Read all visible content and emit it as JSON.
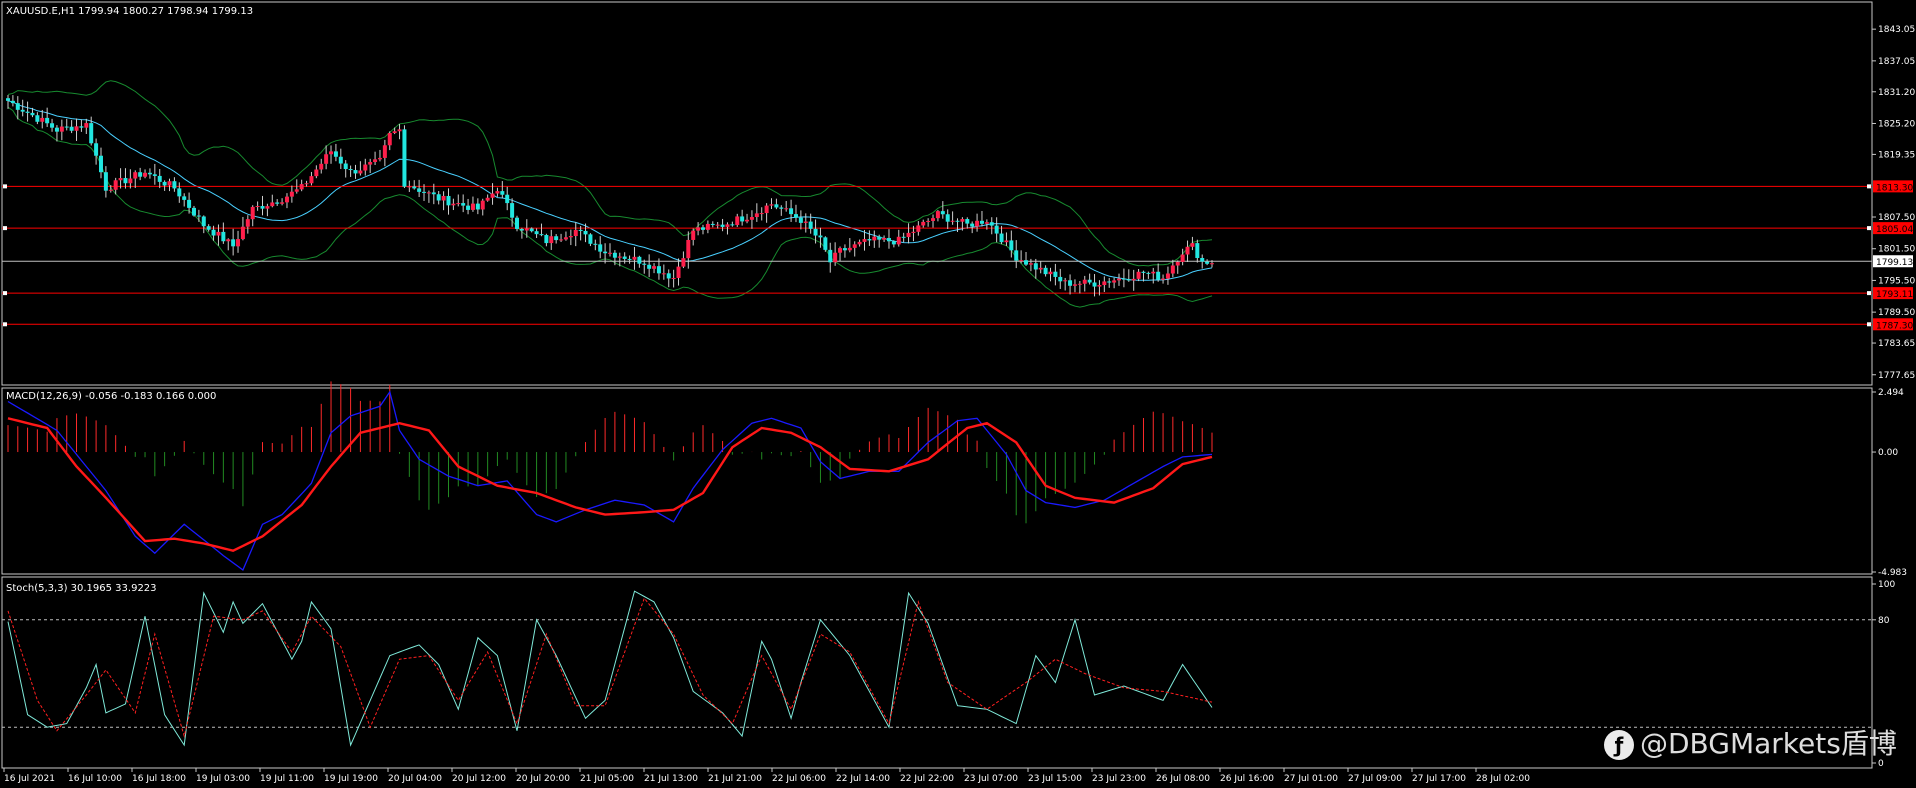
{
  "colors": {
    "bg": "#000000",
    "frame": "#c8c8c8",
    "bull": "#ff1f4b",
    "bear": "#21e6e0",
    "ma": "#49d0ff",
    "bands": "#178a2f",
    "level": "#ff0000",
    "current": "#c0c0c0",
    "macd_line": "#1a1aff",
    "macd_signal": "#ff1818",
    "hist_pos": "#ff2a2a",
    "hist_neg": "#228b22",
    "stoch_main": "#7fe9d9",
    "stoch_signal": "#ff2020",
    "text": "#ffffff"
  },
  "main": {
    "header": "XAUUSD.E,H1  1799.94 1800.27 1798.94 1799.13",
    "ylim": [
      1775.9,
      1848.0
    ],
    "ticks": [
      "1843.05",
      "1837.05",
      "1831.20",
      "1825.20",
      "1819.35",
      "1807.50",
      "1801.50",
      "1795.50",
      "1789.50",
      "1783.65",
      "1777.65"
    ],
    "current_price": "1799.13",
    "levels": [
      {
        "value": 1813.3,
        "label": "1813.30"
      },
      {
        "value": 1805.4,
        "label": "1805.04"
      },
      {
        "value": 1793.1,
        "label": "1793.11"
      },
      {
        "value": 1787.2,
        "label": "1787.30"
      }
    ]
  },
  "macd": {
    "header": "MACD(12,26,9) -0.056 -0.183 0.166 0.000",
    "ylim": [
      -4.983,
      2.494
    ],
    "ticks": [
      "2.494",
      "0.00",
      "-4.983"
    ]
  },
  "stoch": {
    "header": "Stoch(5,3,3) 30.1965 33.9223",
    "ylim": [
      0,
      100
    ],
    "ticks": [
      "100",
      "80",
      "0"
    ],
    "levels": [
      80,
      20
    ]
  },
  "time_labels": [
    "16 Jul 2021",
    "16 Jul 10:00",
    "16 Jul 18:00",
    "19 Jul 03:00",
    "19 Jul 11:00",
    "19 Jul 19:00",
    "20 Jul 04:00",
    "20 Jul 12:00",
    "20 Jul 20:00",
    "21 Jul 05:00",
    "21 Jul 13:00",
    "21 Jul 21:00",
    "22 Jul 06:00",
    "22 Jul 14:00",
    "22 Jul 22:00",
    "23 Jul 07:00",
    "23 Jul 15:00",
    "23 Jul 23:00",
    "26 Jul 08:00",
    "26 Jul 16:00",
    "27 Jul 01:00",
    "27 Jul 09:00",
    "27 Jul 17:00",
    "28 Jul 02:00"
  ],
  "watermark": "@DBGMarkets盾博",
  "chart_data": [
    {
      "type": "candlestick",
      "title": "XAUUSD.E,H1",
      "ohlc_last": {
        "open": 1799.94,
        "high": 1800.27,
        "low": 1798.94,
        "close": 1799.13
      },
      "ylim": [
        1775.9,
        1848.0
      ],
      "close_path": [
        [
          0,
          1829.5
        ],
        [
          10,
          1824
        ],
        [
          16,
          1825
        ],
        [
          20,
          1813
        ],
        [
          28,
          1816
        ],
        [
          34,
          1813
        ],
        [
          40,
          1806
        ],
        [
          46,
          1802
        ],
        [
          50,
          1809
        ],
        [
          56,
          1811
        ],
        [
          60,
          1813
        ],
        [
          66,
          1820
        ],
        [
          70,
          1816
        ],
        [
          76,
          1818
        ],
        [
          78,
          1823
        ],
        [
          80,
          1824
        ],
        [
          81,
          1814
        ],
        [
          88,
          1811
        ],
        [
          96,
          1809
        ],
        [
          100,
          1813
        ],
        [
          104,
          1806
        ],
        [
          110,
          1803
        ],
        [
          116,
          1805
        ],
        [
          122,
          1801
        ],
        [
          130,
          1799
        ],
        [
          136,
          1796
        ],
        [
          140,
          1805
        ],
        [
          146,
          1806
        ],
        [
          152,
          1808
        ],
        [
          156,
          1810
        ],
        [
          162,
          1807
        ],
        [
          166,
          1803
        ],
        [
          168,
          1799
        ],
        [
          170,
          1801
        ],
        [
          176,
          1803
        ],
        [
          182,
          1803
        ],
        [
          190,
          1808
        ],
        [
          196,
          1806
        ],
        [
          200,
          1807
        ],
        [
          206,
          1800
        ],
        [
          212,
          1797
        ],
        [
          216,
          1795
        ],
        [
          222,
          1795
        ],
        [
          228,
          1796
        ],
        [
          232,
          1797
        ],
        [
          236,
          1796
        ],
        [
          240,
          1801
        ],
        [
          242,
          1802
        ],
        [
          244,
          1799
        ],
        [
          246,
          1799
        ]
      ],
      "horizontal_levels": [
        1813.3,
        1805.04,
        1793.11,
        1787.3
      ],
      "current": 1799.13
    },
    {
      "type": "line",
      "title": "MACD(12,26,9)",
      "values_last": {
        "macd": -0.056,
        "signal": -0.183,
        "hist": 0.166
      },
      "ylim": [
        -4.983,
        2.494
      ],
      "series": [
        {
          "name": "MACD",
          "values": [
            [
              0,
              2.1
            ],
            [
              10,
              0.9
            ],
            [
              20,
              -1.6
            ],
            [
              26,
              -3.5
            ],
            [
              30,
              -4.2
            ],
            [
              36,
              -3.0
            ],
            [
              44,
              -4.3
            ],
            [
              48,
              -4.9
            ],
            [
              52,
              -3.0
            ],
            [
              56,
              -2.6
            ],
            [
              62,
              -1.3
            ],
            [
              66,
              0.8
            ],
            [
              70,
              1.5
            ],
            [
              76,
              1.9
            ],
            [
              78,
              2.5
            ],
            [
              80,
              0.9
            ],
            [
              84,
              -0.3
            ],
            [
              90,
              -1.0
            ],
            [
              96,
              -1.4
            ],
            [
              102,
              -1.2
            ],
            [
              108,
              -2.6
            ],
            [
              112,
              -2.9
            ],
            [
              118,
              -2.4
            ],
            [
              124,
              -2.0
            ],
            [
              130,
              -2.2
            ],
            [
              136,
              -2.9
            ],
            [
              140,
              -1.5
            ],
            [
              146,
              0.1
            ],
            [
              152,
              1.2
            ],
            [
              156,
              1.4
            ],
            [
              162,
              1.0
            ],
            [
              166,
              -0.4
            ],
            [
              170,
              -1.1
            ],
            [
              176,
              -0.8
            ],
            [
              182,
              -0.8
            ],
            [
              188,
              0.4
            ],
            [
              194,
              1.3
            ],
            [
              198,
              1.4
            ],
            [
              204,
              -0.1
            ],
            [
              208,
              -1.6
            ],
            [
              212,
              -2.1
            ],
            [
              218,
              -2.3
            ],
            [
              224,
              -2.0
            ],
            [
              230,
              -1.3
            ],
            [
              236,
              -0.6
            ],
            [
              240,
              -0.2
            ],
            [
              246,
              -0.1
            ]
          ]
        },
        {
          "name": "Signal",
          "values": [
            [
              0,
              1.4
            ],
            [
              8,
              1.0
            ],
            [
              14,
              -0.6
            ],
            [
              20,
              -1.9
            ],
            [
              28,
              -3.7
            ],
            [
              34,
              -3.6
            ],
            [
              40,
              -3.8
            ],
            [
              46,
              -4.1
            ],
            [
              52,
              -3.5
            ],
            [
              60,
              -2.2
            ],
            [
              66,
              -0.6
            ],
            [
              72,
              0.8
            ],
            [
              80,
              1.2
            ],
            [
              86,
              0.9
            ],
            [
              92,
              -0.6
            ],
            [
              100,
              -1.4
            ],
            [
              108,
              -1.7
            ],
            [
              116,
              -2.3
            ],
            [
              122,
              -2.6
            ],
            [
              130,
              -2.5
            ],
            [
              136,
              -2.4
            ],
            [
              142,
              -1.7
            ],
            [
              148,
              0.2
            ],
            [
              154,
              1.0
            ],
            [
              160,
              0.8
            ],
            [
              166,
              0.2
            ],
            [
              172,
              -0.7
            ],
            [
              180,
              -0.8
            ],
            [
              188,
              -0.3
            ],
            [
              196,
              1.0
            ],
            [
              200,
              1.2
            ],
            [
              206,
              0.4
            ],
            [
              212,
              -1.4
            ],
            [
              218,
              -1.9
            ],
            [
              226,
              -2.1
            ],
            [
              234,
              -1.5
            ],
            [
              240,
              -0.5
            ],
            [
              246,
              -0.2
            ]
          ]
        }
      ]
    },
    {
      "type": "line",
      "title": "Stoch(5,3,3)",
      "values_last": {
        "main": 30.1965,
        "signal": 33.9223
      },
      "ylim": [
        0,
        100
      ],
      "series": [
        {
          "name": "Main",
          "values": [
            [
              0,
              79
            ],
            [
              4,
              27
            ],
            [
              8,
              20
            ],
            [
              12,
              22
            ],
            [
              16,
              42
            ],
            [
              18,
              55
            ],
            [
              20,
              28
            ],
            [
              24,
              33
            ],
            [
              28,
              82
            ],
            [
              32,
              27
            ],
            [
              36,
              10
            ],
            [
              40,
              95
            ],
            [
              44,
              73
            ],
            [
              46,
              90
            ],
            [
              48,
              78
            ],
            [
              52,
              89
            ],
            [
              58,
              58
            ],
            [
              60,
              68
            ],
            [
              62,
              90
            ],
            [
              66,
              75
            ],
            [
              70,
              10
            ],
            [
              74,
              35
            ],
            [
              78,
              60
            ],
            [
              84,
              66
            ],
            [
              88,
              55
            ],
            [
              92,
              30
            ],
            [
              96,
              70
            ],
            [
              100,
              60
            ],
            [
              104,
              18
            ],
            [
              108,
              80
            ],
            [
              112,
              60
            ],
            [
              118,
              25
            ],
            [
              122,
              35
            ],
            [
              128,
              96
            ],
            [
              132,
              90
            ],
            [
              136,
              70
            ],
            [
              140,
              40
            ],
            [
              146,
              28
            ],
            [
              150,
              15
            ],
            [
              154,
              68
            ],
            [
              156,
              58
            ],
            [
              160,
              25
            ],
            [
              162,
              45
            ],
            [
              166,
              80
            ],
            [
              172,
              60
            ],
            [
              180,
              20
            ],
            [
              184,
              95
            ],
            [
              188,
              78
            ],
            [
              194,
              32
            ],
            [
              200,
              30
            ],
            [
              206,
              22
            ],
            [
              210,
              60
            ],
            [
              214,
              45
            ],
            [
              218,
              80
            ],
            [
              222,
              38
            ],
            [
              228,
              43
            ],
            [
              236,
              35
            ],
            [
              240,
              55
            ],
            [
              246,
              31
            ]
          ]
        },
        {
          "name": "Signal",
          "values": [
            [
              0,
              85
            ],
            [
              6,
              35
            ],
            [
              10,
              18
            ],
            [
              16,
              38
            ],
            [
              20,
              52
            ],
            [
              26,
              28
            ],
            [
              30,
              72
            ],
            [
              36,
              15
            ],
            [
              42,
              82
            ],
            [
              48,
              80
            ],
            [
              52,
              85
            ],
            [
              58,
              62
            ],
            [
              62,
              82
            ],
            [
              68,
              65
            ],
            [
              74,
              20
            ],
            [
              80,
              58
            ],
            [
              86,
              60
            ],
            [
              92,
              35
            ],
            [
              98,
              62
            ],
            [
              104,
              22
            ],
            [
              110,
              72
            ],
            [
              116,
              32
            ],
            [
              122,
              32
            ],
            [
              130,
              92
            ],
            [
              136,
              72
            ],
            [
              142,
              38
            ],
            [
              148,
              22
            ],
            [
              154,
              60
            ],
            [
              160,
              30
            ],
            [
              166,
              72
            ],
            [
              172,
              62
            ],
            [
              180,
              22
            ],
            [
              186,
              90
            ],
            [
              192,
              45
            ],
            [
              200,
              30
            ],
            [
              208,
              45
            ],
            [
              214,
              58
            ],
            [
              220,
              50
            ],
            [
              228,
              42
            ],
            [
              236,
              40
            ],
            [
              246,
              34
            ]
          ]
        }
      ],
      "levels": [
        80,
        20
      ]
    }
  ]
}
